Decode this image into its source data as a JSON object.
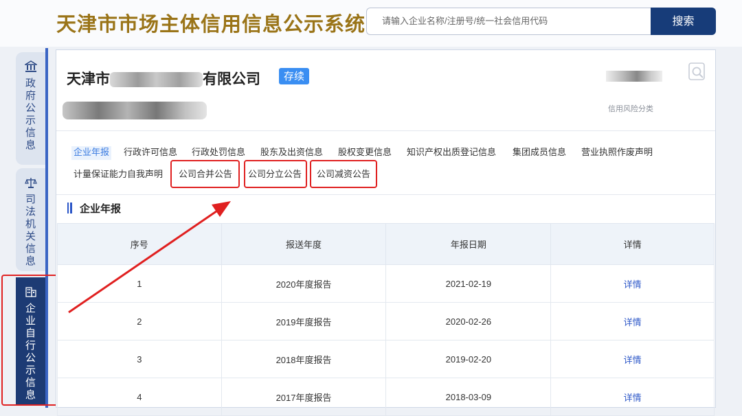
{
  "header": {
    "site_title": "天津市市场主体信用信息公示系统",
    "search_placeholder": "请输入企业名称/注册号/统一社会信用代码",
    "search_button": "搜索"
  },
  "sidebar": {
    "items": [
      {
        "label": "政府公示信息",
        "icon": "government-building-icon"
      },
      {
        "label": "司法机关信息",
        "icon": "judicial-scales-icon"
      },
      {
        "label": "企业自行公示信息",
        "icon": "enterprise-building-icon",
        "active": true
      }
    ]
  },
  "company": {
    "name_prefix": "天津市",
    "name_suffix": "有限公司",
    "status": "存续",
    "risk_label": "信用风险分类"
  },
  "tabs": [
    {
      "label": "企业年报",
      "active": true
    },
    {
      "label": "行政许可信息"
    },
    {
      "label": "行政处罚信息"
    },
    {
      "label": "股东及出资信息"
    },
    {
      "label": "股权变更信息"
    },
    {
      "label": "知识产权出质登记信息"
    },
    {
      "label": "集团成员信息"
    },
    {
      "label": "营业执照作废声明"
    },
    {
      "label": "计量保证能力自我声明"
    },
    {
      "label": "公司合并公告"
    },
    {
      "label": "公司分立公告"
    },
    {
      "label": "公司减资公告"
    }
  ],
  "section": {
    "title": "企业年报"
  },
  "table": {
    "headers": [
      "序号",
      "报送年度",
      "年报日期",
      "详情"
    ],
    "rows": [
      {
        "index": "1",
        "year": "2020年度报告",
        "date": "2021-02-19",
        "detail": "详情"
      },
      {
        "index": "2",
        "year": "2019年度报告",
        "date": "2020-02-26",
        "detail": "详情"
      },
      {
        "index": "3",
        "year": "2018年度报告",
        "date": "2019-02-20",
        "detail": "详情"
      },
      {
        "index": "4",
        "year": "2017年度报告",
        "date": "2018-03-09",
        "detail": "详情"
      }
    ]
  },
  "colors": {
    "accent": "#173c79",
    "highlight": "#e02020",
    "title": "#9a7418"
  }
}
